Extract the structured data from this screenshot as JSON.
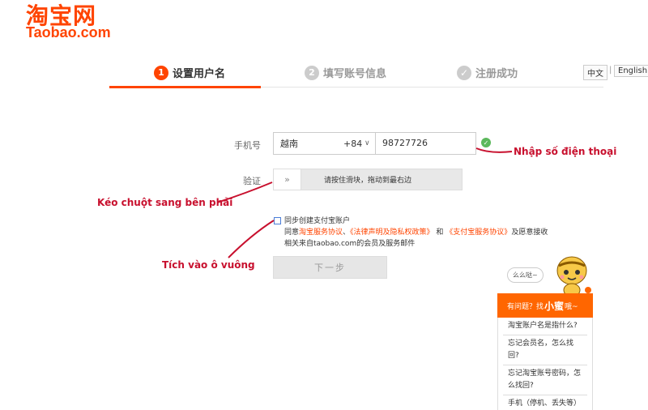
{
  "logo": {
    "cn": "淘宝网",
    "en": "Taobao.com"
  },
  "steps": [
    {
      "num": "1",
      "label": "设置用户名"
    },
    {
      "num": "2",
      "label": "填写账号信息"
    },
    {
      "num": "✓",
      "label": "注册成功"
    }
  ],
  "lang": {
    "cn": "中文",
    "sep": "|",
    "en": "English"
  },
  "form": {
    "phone_label": "手机号",
    "country": "越南",
    "country_code": "+84",
    "phone_value": "98727726",
    "verify_label": "验证",
    "slider_handle": "»",
    "slider_text": "请按住滑块，拖动到最右边",
    "agree_line1": "同步创建支付宝账户",
    "agree_prefix": "同意",
    "agree_link1": "淘宝服务协议",
    "agree_sep": "、",
    "agree_link2": "《法律声明及隐私权政策》",
    "agree_and": " 和 ",
    "agree_link3": "《支付宝服务协议》",
    "agree_suffix": "及愿意接收",
    "agree_line3": "相关来自taobao.com的会员及服务邮件",
    "next_button": "下一步"
  },
  "annotations": {
    "phone": "Nhập số điện thoại",
    "slider": "Kéo chuột sang bên phải",
    "checkbox": "Tích vào ô vuông"
  },
  "help": {
    "bubble": "么么哒~",
    "head_prefix": "有问题？找",
    "head_name": "小蜜",
    "head_suffix": "哦~",
    "items": [
      "淘宝账户名是指什么?",
      "忘记会员名，怎么找回?",
      "忘记淘宝账号密码，怎么找回?",
      "手机（停机、丢失等）"
    ]
  },
  "colors": {
    "brand": "#ff4400",
    "annotation": "#c8102e",
    "success": "#5cb85c"
  }
}
